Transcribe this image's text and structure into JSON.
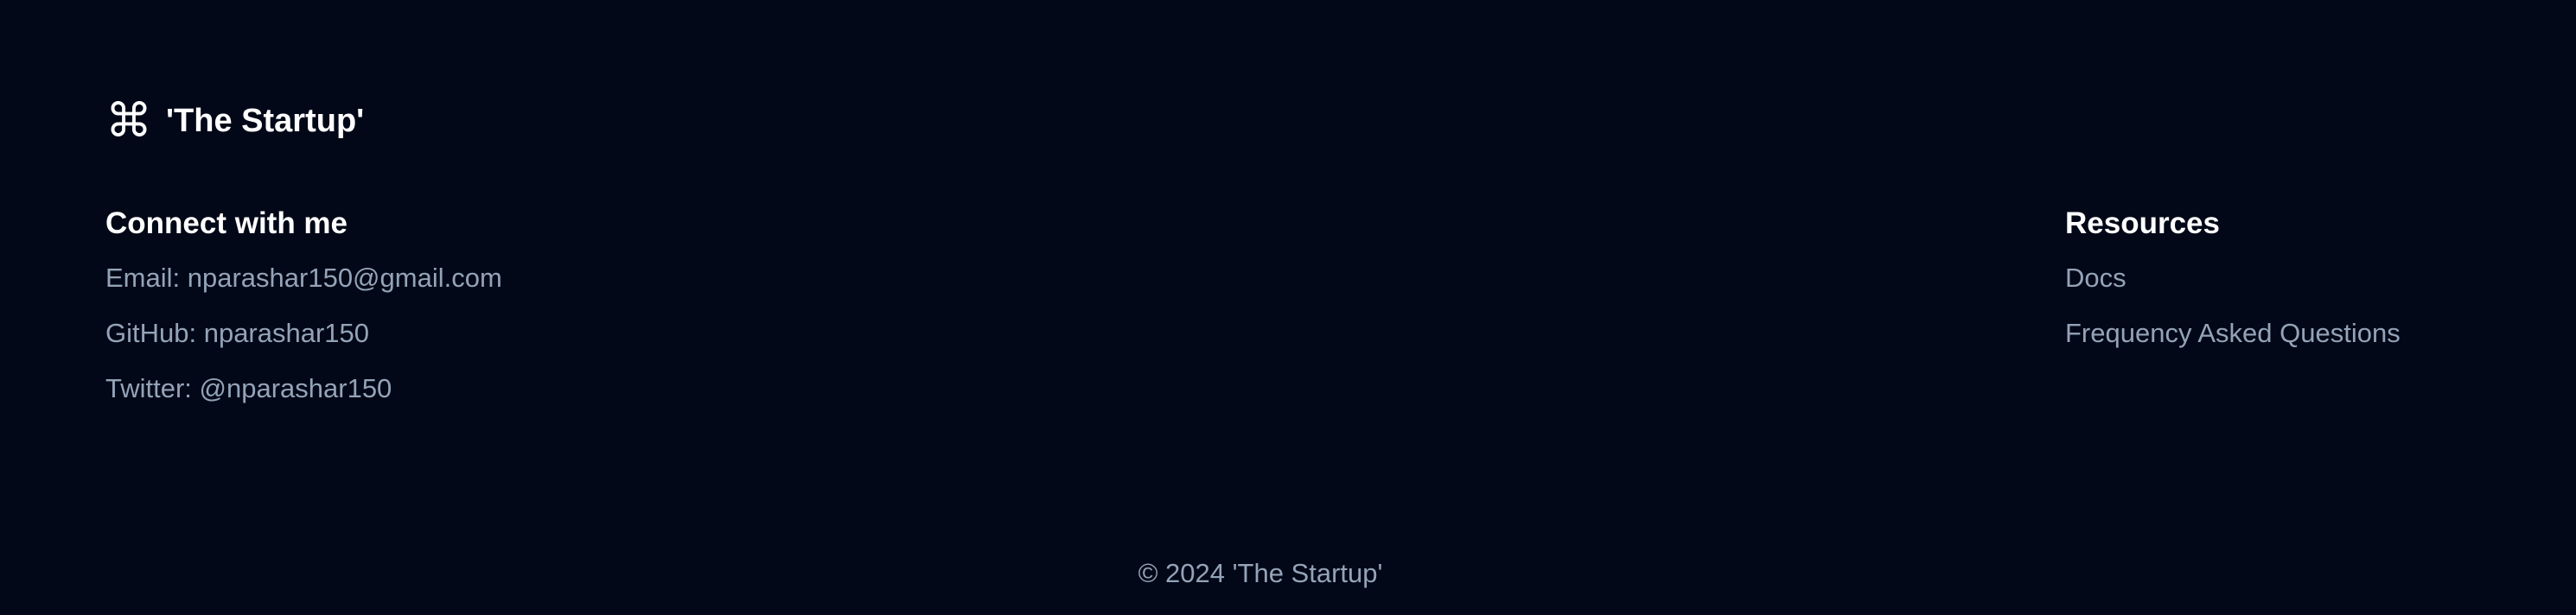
{
  "brand": {
    "icon": "command-icon",
    "icon_glyph": "⌘",
    "name": "'The Startup'"
  },
  "connect": {
    "title": "Connect with me",
    "items": [
      "Email: nparashar150@gmail.com",
      "GitHub: nparashar150",
      "Twitter: @nparashar150"
    ]
  },
  "resources": {
    "title": "Resources",
    "items": [
      "Docs",
      "Frequency Asked Questions"
    ]
  },
  "copyright": "© 2024 'The Startup'",
  "colors": {
    "background": "#020817",
    "heading": "#ffffff",
    "muted": "#94a3b8"
  }
}
